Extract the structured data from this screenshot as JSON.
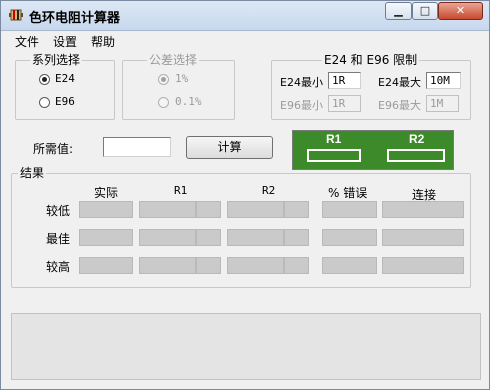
{
  "window": {
    "title": "色环电阻计算器",
    "min_glyph": "▁",
    "max_glyph": "□",
    "close_glyph": "✕"
  },
  "menu": [
    "文件",
    "设置",
    "帮助"
  ],
  "series_group": {
    "label": "系列选择",
    "options": [
      "E24",
      "E96"
    ],
    "selected": "E24"
  },
  "tolerance_group": {
    "label": "公差选择",
    "options": [
      "1%",
      "0.1%"
    ],
    "selected": "1%",
    "enabled": false
  },
  "limits_group": {
    "label": "E24 和 E96 限制",
    "e24_min_label": "E24最小",
    "e24_min_value": "1R",
    "e24_max_label": "E24最大",
    "e24_max_value": "10M",
    "e96_min_label": "E96最小",
    "e96_min_value": "1R",
    "e96_max_label": "E96最大",
    "e96_max_value": "1M"
  },
  "required": {
    "label": "所需值:",
    "value": ""
  },
  "calc_button": "计算",
  "resistor_display": {
    "r1": "R1",
    "r2": "R2",
    "bg_color": "#3d8a2a"
  },
  "results": {
    "label": "结果",
    "columns": [
      "实际",
      "R1",
      "R2",
      "% 错误",
      "连接"
    ],
    "rows": [
      "较低",
      "最佳",
      "较高"
    ]
  },
  "status": ""
}
